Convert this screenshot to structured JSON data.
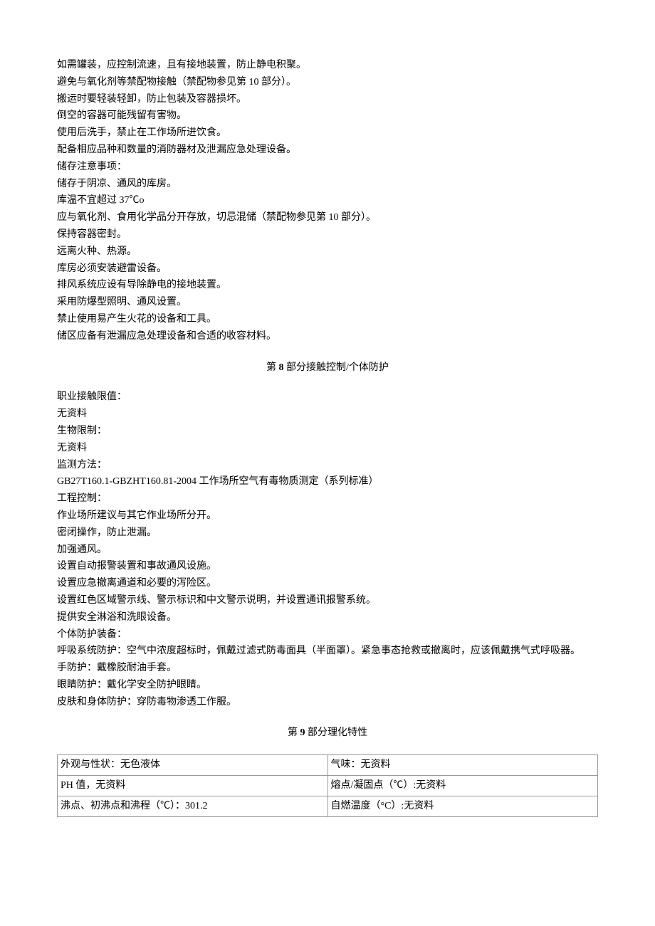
{
  "handling": {
    "lines": [
      "如需罐装，应控制流速，且有接地装置，防止静电积聚。",
      "避免与氧化剂等禁配物接触（禁配物参见第 10 部分）。",
      "搬运时要轻装轻卸，防止包装及容器损坏。",
      "倒空的容器可能残留有害物。",
      "使用后洗手，禁止在工作场所进饮食。",
      "配备相应品种和数量的消防器材及泄漏应急处理设备。",
      "储存注意事项：",
      "储存于阴凉、通风的库房。",
      "库温不宜超过 37℃o",
      "应与氧化剂、食用化学品分开存放，切忌混储（禁配物参见第 10 部分）。",
      "保持容器密封。",
      "远离火种、热源。",
      "库房必须安装避雷设备。",
      "排风系统应设有导除静电的接地装置。",
      "采用防爆型照明、通风设置。",
      "禁止使用易产生火花的设备和工具。",
      "储区应备有泄漏应急处理设备和合适的收容材料。"
    ]
  },
  "section8": {
    "heading_prefix": "第 ",
    "heading_num": "8",
    "heading_suffix": " 部分接触控制/个体防护",
    "lines": [
      "职业接触限值：",
      "无资料",
      "生物限制：",
      "无资料",
      "监测方法：",
      "GB27T160.1-GBZHT160.81-2004 工作场所空气有毒物质测定（系列标准）",
      "工程控制：",
      "作业场所建议与其它作业场所分开。",
      "密闭操作，防止泄漏。",
      "加强通风。",
      "设置自动报警装置和事故通风设施。",
      "设置应急撤离通道和必要的泻险区。",
      "设置红色区域警示线、警示标识和中文警示说明，并设置通讯报警系统。",
      "提供安全淋浴和洗眼设备。",
      "个体防护装备：",
      "呼吸系统防护：空气中浓度超标时，佩戴过滤式防毒面具（半面罩）。紧急事态抢救或撤离时，应该佩戴携气式呼吸器。",
      "手防护：戴橡胶耐油手套。",
      "眼睛防护：戴化学安全防护眼睛。",
      "皮肤和身体防护：穿防毒物渗透工作服。"
    ]
  },
  "section9": {
    "heading_prefix": "第 ",
    "heading_num": "9",
    "heading_suffix": " 部分理化特性",
    "rows": [
      {
        "left": "外观与性状：无色液体",
        "right": "气味：无资料"
      },
      {
        "left": "PH 值，无资料",
        "right": "熔点/凝固点（℃）:无资料"
      },
      {
        "left": "沸点、初沸点和沸程（℃）：301.2",
        "right": "自燃温度（°C）:无资料"
      }
    ]
  }
}
